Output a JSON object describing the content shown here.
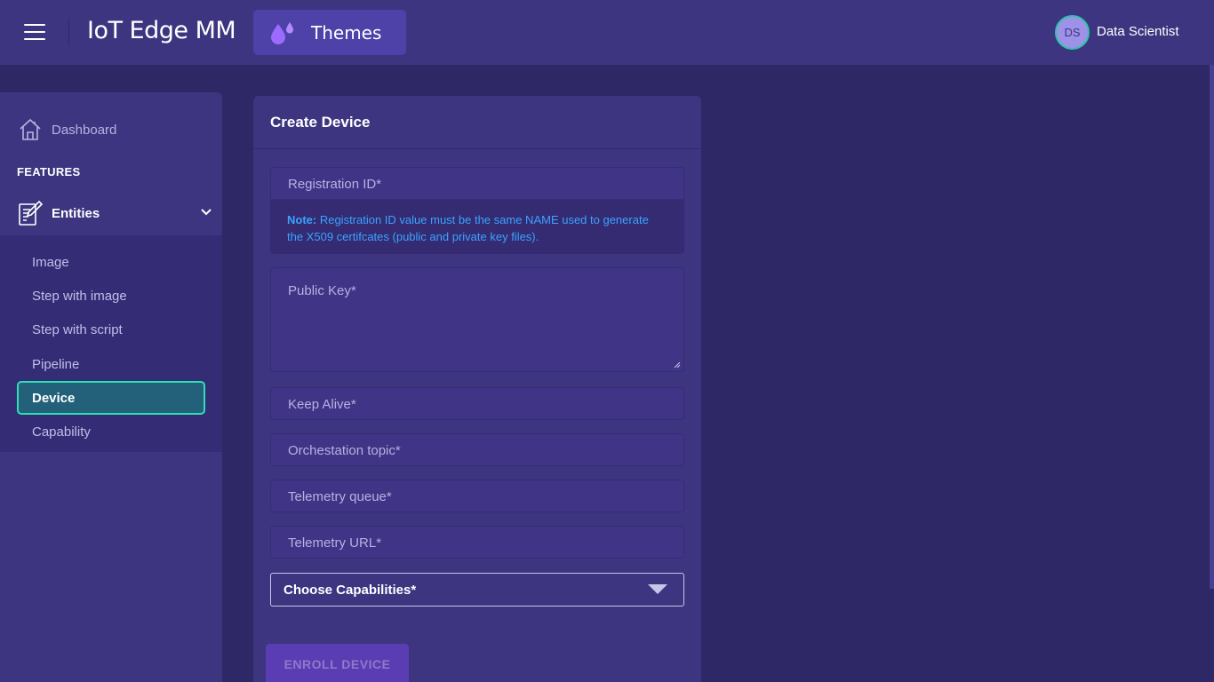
{
  "header": {
    "app_title": "IoT Edge MM",
    "themes_label": "Themes",
    "user": {
      "initials": "DS",
      "name": "Data Scientist"
    }
  },
  "sidebar": {
    "dashboard_label": "Dashboard",
    "section_label": "FEATURES",
    "entities_label": "Entities",
    "items": [
      {
        "label": "Image",
        "active": false
      },
      {
        "label": "Step with image",
        "active": false
      },
      {
        "label": "Step with script",
        "active": false
      },
      {
        "label": "Pipeline",
        "active": false
      },
      {
        "label": "Device",
        "active": true
      },
      {
        "label": "Capability",
        "active": false
      }
    ]
  },
  "form": {
    "title": "Create Device",
    "registration_id_placeholder": "Registration ID*",
    "note_label": "Note:",
    "note_text": " Registration ID value must be the same NAME used to generate the X509 certifcates (public and private key files).",
    "public_key_placeholder": "Public Key*",
    "keep_alive_placeholder": "Keep Alive*",
    "orchestration_topic_placeholder": "Orchestation topic*",
    "telemetry_queue_placeholder": "Telemetry queue*",
    "telemetry_url_placeholder": "Telemetry URL*",
    "capabilities_select": "Choose Capabilities*",
    "submit_label": "ENROLL DEVICE"
  },
  "colors": {
    "header_bg": "#3d3580",
    "page_bg": "#2e2866",
    "active_item_border": "#2de0b5",
    "note_text": "#3ba3ff",
    "submit_bg": "#5a3db3"
  }
}
